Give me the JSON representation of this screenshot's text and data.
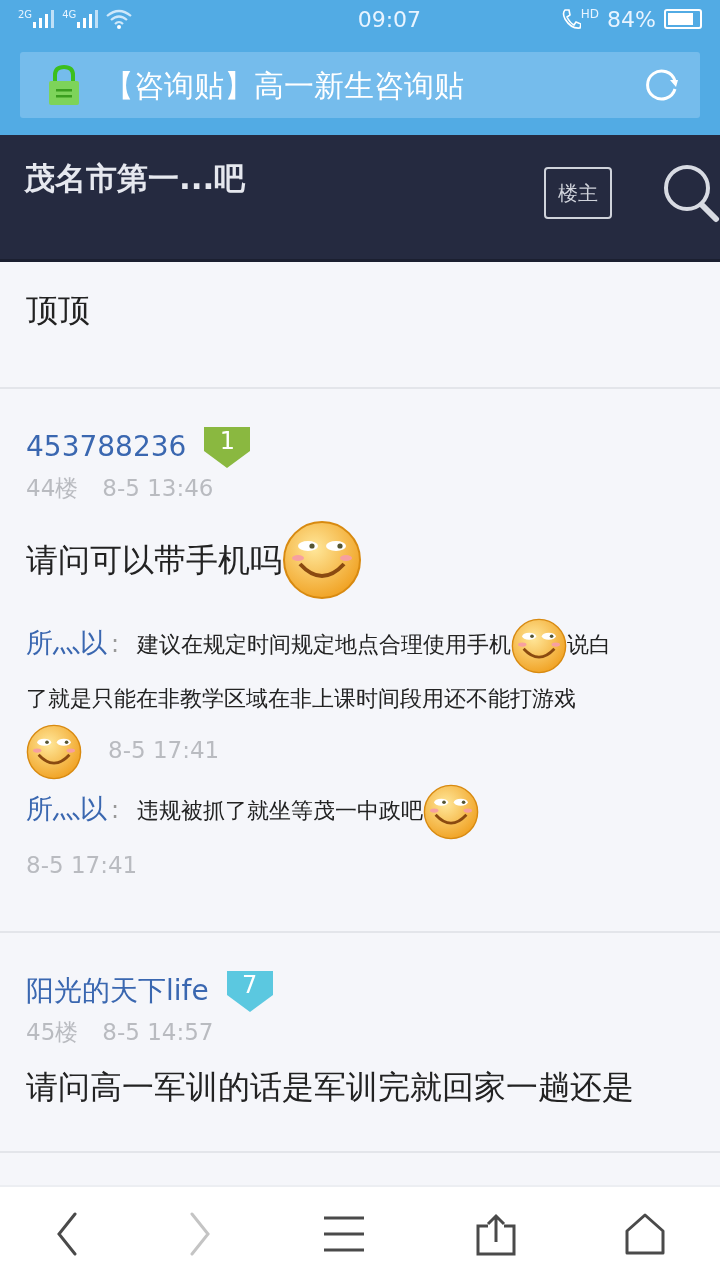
{
  "status_bar": {
    "networks": [
      "2G",
      "4G"
    ],
    "time": "09:07",
    "hd": "HD",
    "battery": "84%"
  },
  "url_bar": {
    "title": "【咨询贴】高一新生咨询贴"
  },
  "header": {
    "forum": "茂名市第一...吧",
    "owner_button": "楼主"
  },
  "posts": [
    {
      "kind": "plain",
      "content": [
        {
          "kind": "text",
          "text": "顶顶"
        }
      ]
    },
    {
      "kind": "floor",
      "user": "453788236",
      "level": "1",
      "color": "#8ab840",
      "floor": "44楼",
      "time": "8-5 13:46",
      "content": [
        {
          "kind": "text",
          "text": "请问可以带手机吗"
        },
        {
          "kind": "emoji"
        }
      ],
      "replies": [
        {
          "user": "所灬以",
          "colon": ":",
          "parts": [
            {
              "kind": "text",
              "text": "建议在规定时间规定地点合理使用手机"
            },
            {
              "kind": "emoji"
            },
            {
              "kind": "text",
              "text": "说白"
            },
            {
              "kind": "break"
            },
            {
              "kind": "text",
              "text": "了就是只能在非教学区域在非上课时间段用还不能打游戏"
            },
            {
              "kind": "break"
            },
            {
              "kind": "emoji"
            }
          ],
          "time": "8-5 17:41"
        },
        {
          "user": "所灬以",
          "colon": ":",
          "parts": [
            {
              "kind": "text",
              "text": "违规被抓了就坐等茂一中政吧"
            },
            {
              "kind": "emoji"
            },
            {
              "kind": "break"
            }
          ],
          "time": "8-5 17:41"
        }
      ]
    },
    {
      "kind": "floor",
      "user": "阳光的天下life",
      "level": "7",
      "color": "#5bc8e0",
      "floor": "45楼",
      "time": "8-5 14:57",
      "content": [
        {
          "kind": "text",
          "text": "请问高一军训的话是军训完就回家一趟还是"
        }
      ]
    }
  ],
  "toolbar": [
    {
      "kind": "back",
      "disabled": false
    },
    {
      "kind": "forward",
      "disabled": true
    },
    {
      "kind": "menu",
      "disabled": false
    },
    {
      "kind": "share",
      "disabled": false
    },
    {
      "kind": "home",
      "disabled": false
    }
  ]
}
